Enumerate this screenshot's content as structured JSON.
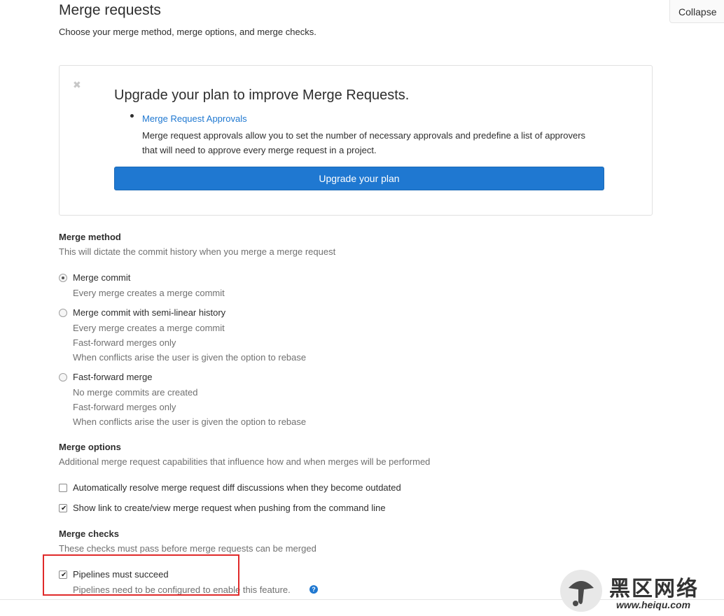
{
  "header": {
    "title": "Merge requests",
    "description": "Choose your merge method, merge options, and merge checks.",
    "collapse_label": "Collapse"
  },
  "promo": {
    "close_glyph": "✖",
    "heading": "Upgrade your plan to improve Merge Requests.",
    "feature_link": "Merge Request Approvals",
    "feature_text": "Merge request approvals allow you to set the number of necessary approvals and predefine a list of approvers that will need to approve every merge request in a project.",
    "button_label": "Upgrade your plan"
  },
  "merge_method": {
    "title": "Merge method",
    "description": "This will dictate the commit history when you merge a merge request",
    "options": [
      {
        "label": "Merge commit",
        "checked": true,
        "help": [
          "Every merge creates a merge commit"
        ]
      },
      {
        "label": "Merge commit with semi-linear history",
        "checked": false,
        "help": [
          "Every merge creates a merge commit",
          "Fast-forward merges only",
          "When conflicts arise the user is given the option to rebase"
        ]
      },
      {
        "label": "Fast-forward merge",
        "checked": false,
        "help": [
          "No merge commits are created",
          "Fast-forward merges only",
          "When conflicts arise the user is given the option to rebase"
        ]
      }
    ]
  },
  "merge_options": {
    "title": "Merge options",
    "description": "Additional merge request capabilities that influence how and when merges will be performed",
    "options": [
      {
        "label": "Automatically resolve merge request diff discussions when they become outdated",
        "checked": false
      },
      {
        "label": "Show link to create/view merge request when pushing from the command line",
        "checked": true
      }
    ]
  },
  "merge_checks": {
    "title": "Merge checks",
    "description": "These checks must pass before merge requests can be merged",
    "options": [
      {
        "label": "Pipelines must succeed",
        "checked": true,
        "help": "Pipelines need to be configured to enable this feature."
      }
    ]
  },
  "watermark": {
    "text": "黑区网络",
    "url": "www.heiqu.com"
  },
  "colors": {
    "accent": "#1f78d1",
    "highlight": "#e02a2a"
  }
}
